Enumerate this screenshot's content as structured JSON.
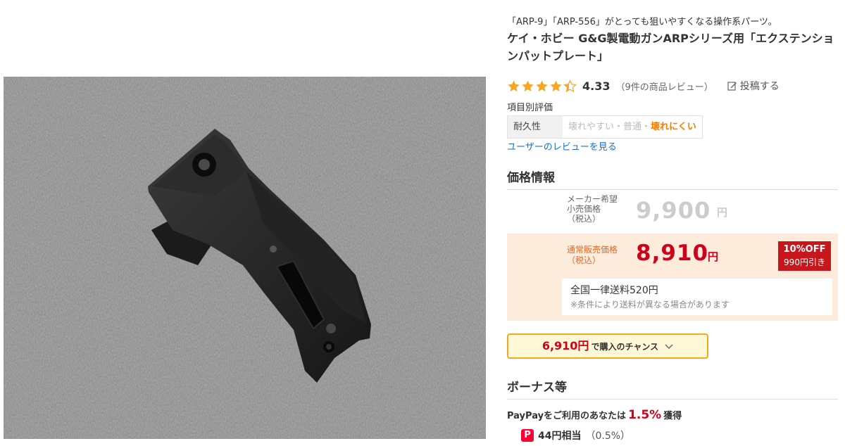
{
  "product": {
    "catch_copy": "「ARP-9」「ARP-556」がとっても狙いやすくなる操作系パーツ。",
    "title": "ケイ・ホビー G&G製電動ガンARPシリーズ用「エクステンションパットプレート」",
    "image_alt": "black extension pad plate on grey felt"
  },
  "rating": {
    "stars": 4.33,
    "value": "4.33",
    "count_text": "（9件の商品レビュー）",
    "post_label": "投稿する",
    "star_color": "#f5a623"
  },
  "item_ratings": {
    "label": "項目別評価",
    "durability": {
      "name": "耐久性",
      "opt1": "壊れやすい",
      "sep1": "・",
      "opt2": "普通",
      "sep2": "・",
      "selected": "壊れにくい"
    }
  },
  "user_reviews_link": "ユーザーのレビューを見る",
  "price": {
    "heading": "価格情報",
    "maker_label_1": "メーカー希望",
    "maker_label_2": "小売価格",
    "maker_label_3": "（税込）",
    "maker_value": "9,900",
    "maker_yen": "円",
    "sale_label_1": "通常販売価格",
    "sale_label_2": "（税込）",
    "sale_value": "8,910",
    "sale_yen": "円",
    "off_pct": "10%OFF",
    "off_amount": "990円引き",
    "shipping": "全国一律送料520円",
    "shipping_note": "※条件により送料が異なる場合があります",
    "accent_color": "#d0021b"
  },
  "chance": {
    "amount": "6,910円",
    "text": "で購入のチャンス"
  },
  "bonus": {
    "heading": "ボーナス等",
    "paypay_prefix": "PayPayをご利用のあなたは",
    "paypay_rate": "1.5%",
    "paypay_suffix": "獲得",
    "points_icon": "P",
    "points_amount": "44円相当",
    "points_rate": "（0.5%）"
  }
}
